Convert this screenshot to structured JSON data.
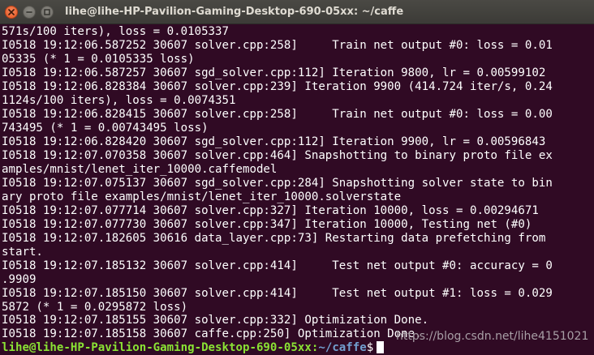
{
  "window": {
    "title": "lihe@lihe-HP-Pavilion-Gaming-Desktop-690-05xx: ~/caffe"
  },
  "terminal": {
    "lines": [
      "571s/100 iters), loss = 0.0105337",
      "I0518 19:12:06.587252 30607 solver.cpp:258]     Train net output #0: loss = 0.01",
      "05335 (* 1 = 0.0105335 loss)",
      "I0518 19:12:06.587257 30607 sgd_solver.cpp:112] Iteration 9800, lr = 0.00599102",
      "I0518 19:12:06.828384 30607 solver.cpp:239] Iteration 9900 (414.724 iter/s, 0.24",
      "1124s/100 iters), loss = 0.0074351",
      "I0518 19:12:06.828415 30607 solver.cpp:258]     Train net output #0: loss = 0.00",
      "743495 (* 1 = 0.00743495 loss)",
      "I0518 19:12:06.828420 30607 sgd_solver.cpp:112] Iteration 9900, lr = 0.00596843",
      "I0518 19:12:07.070358 30607 solver.cpp:464] Snapshotting to binary proto file ex",
      "amples/mnist/lenet_iter_10000.caffemodel",
      "I0518 19:12:07.075137 30607 sgd_solver.cpp:284] Snapshotting solver state to bin",
      "ary proto file examples/mnist/lenet_iter_10000.solverstate",
      "I0518 19:12:07.077714 30607 solver.cpp:327] Iteration 10000, loss = 0.00294671",
      "I0518 19:12:07.077730 30607 solver.cpp:347] Iteration 10000, Testing net (#0)",
      "I0518 19:12:07.182605 30616 data_layer.cpp:73] Restarting data prefetching from",
      "start.",
      "I0518 19:12:07.185132 30607 solver.cpp:414]     Test net output #0: accuracy = 0",
      ".9909",
      "I0518 19:12:07.185150 30607 solver.cpp:414]     Test net output #1: loss = 0.029",
      "5872 (* 1 = 0.0295872 loss)",
      "I0518 19:12:07.185155 30607 solver.cpp:332] Optimization Done.",
      "I0518 19:12:07.185158 30607 caffe.cpp:250] Optimization Done."
    ],
    "prompt": {
      "user_host": "lihe@lihe-HP-Pavilion-Gaming-Desktop-690-05xx",
      "colon": ":",
      "path": "~/caffe",
      "symbol": "$"
    }
  },
  "watermark": "https://blog.csdn.net/lihe4151021",
  "colors": {
    "background": "#300a24",
    "text": "#ffffff",
    "prompt_user": "#8ae234",
    "prompt_path": "#729fcf",
    "close_button": "#e4561f"
  },
  "icons": {
    "close": "close-icon",
    "minimize": "minimize-icon",
    "maximize": "maximize-icon"
  }
}
